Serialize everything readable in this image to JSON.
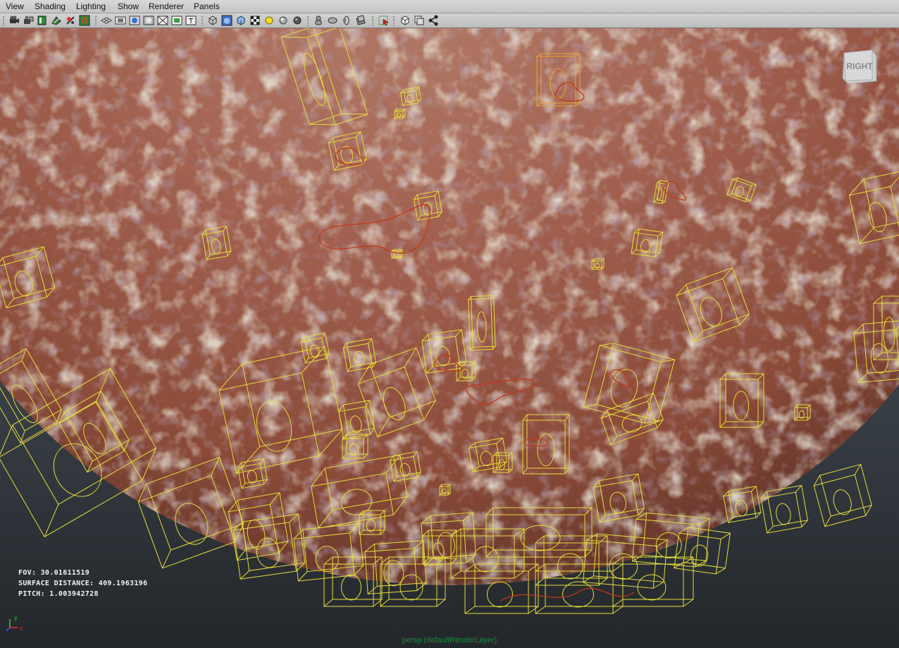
{
  "menubar": {
    "items": [
      "View",
      "Shading",
      "Lighting",
      "Show",
      "Renderer",
      "Panels"
    ]
  },
  "toolbar": {
    "icons": [
      "select-camera-icon",
      "lock-camera-icon",
      "camera-attributes-icon",
      "bookmarks-icon",
      "image-plane-icon",
      "2d-pan-zoom-icon",
      "grid-icon",
      "film-gate-icon",
      "resolution-gate-icon",
      "gate-mask-icon",
      "field-chart-icon",
      "safe-title-icon",
      "wireframe-icon",
      "smooth-shade-icon",
      "wireframe-on-shaded-icon",
      "textured-icon",
      "use-all-lights-icon",
      "shadows-icon",
      "ambient-occlusion-icon",
      "xray-icon",
      "xray-joints-icon",
      "backface-culling-icon",
      "smooth-wireframe-icon",
      "isolate-select-icon",
      "single-pane-icon",
      "two-pane-icon",
      "node-editor-icon"
    ]
  },
  "viewport": {
    "hud": {
      "fov": "FOV: 30.01611519",
      "surface_distance": "SURFACE DISTANCE: 409.1963196",
      "pitch": "PITCH: 1.003942728"
    },
    "camera_label": "persp (defaultRenderLayer)",
    "view_cube_label": "RIGHT",
    "axis": {
      "y": "y",
      "x": "x"
    }
  },
  "colors": {
    "wireframe": "#e6dc3c",
    "wireframe_orange": "#e8a52e",
    "curve": "#c0391b",
    "sphere": "#a55d4e",
    "background_top": "#4d5661",
    "background_bottom": "#23272b"
  }
}
